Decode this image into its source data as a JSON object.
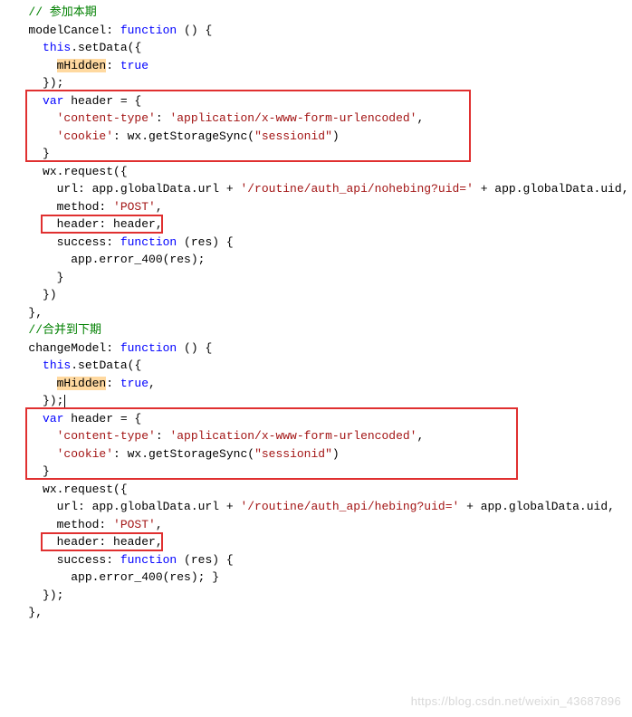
{
  "code": {
    "l1": "// 参加本期",
    "l2a": "modelCancel: ",
    "l2b": "function",
    "l2c": " () {",
    "l3a": "this",
    "l3b": ".setData({",
    "l4a": "mHidden",
    "l4b": ": ",
    "l4c": "true",
    "l5": "});",
    "l6a": "var",
    "l6b": " header = {",
    "l7a": "'content-type'",
    "l7b": ": ",
    "l7c": "'application/x-www-form-urlencoded'",
    "l7d": ",",
    "l8a": "'cookie'",
    "l8b": ": wx.getStorageSync(",
    "l8c": "\"sessionid\"",
    "l8d": ")",
    "l9": "}",
    "l10": "wx.request({",
    "l11a": "url: app.globalData.url + ",
    "l11b": "'/routine/auth_api/nohebing?uid='",
    "l11c": " + app.globalData.uid,",
    "l12a": "method: ",
    "l12b": "'POST'",
    "l12c": ",",
    "l13": "header: header,",
    "l14a": "success: ",
    "l14b": "function",
    "l14c": " (res) {",
    "l15": "app.error_400(res);",
    "l16": "}",
    "l17": "})",
    "l18": "},",
    "l19": "//合并到下期",
    "l20a": "changeModel: ",
    "l20b": "function",
    "l20c": " () {",
    "l21a": "this",
    "l21b": ".setData({",
    "l22a": "mHidden",
    "l22b": ": ",
    "l22c": "true",
    "l22d": ",",
    "l23": "});",
    "l24a": "var",
    "l24b": " header = {",
    "l25a": "'content-type'",
    "l25b": ": ",
    "l25c": "'application/x-www-form-urlencoded'",
    "l25d": ",",
    "l26a": "'cookie'",
    "l26b": ": wx.getStorageSync(",
    "l26c": "\"sessionid\"",
    "l26d": ")",
    "l27": "}",
    "l28": "wx.request({",
    "l29a": "url: app.globalData.url + ",
    "l29b": "'/routine/auth_api/hebing?uid='",
    "l29c": " + app.globalData.uid,",
    "l30a": "method: ",
    "l30b": "'POST'",
    "l30c": ",",
    "l31": "header: header,",
    "l32a": "success: ",
    "l32b": "function",
    "l32c": " (res) {",
    "l33": "app.error_400(res); }",
    "l34": "});",
    "l35": "},"
  },
  "watermark": "https://blog.csdn.net/weixin_43687896"
}
